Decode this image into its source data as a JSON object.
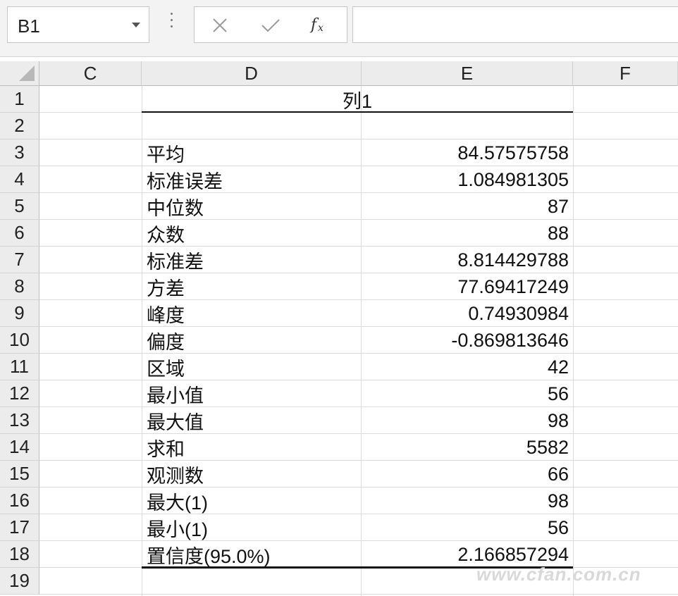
{
  "formula_bar": {
    "name_box": "B1",
    "formula": ""
  },
  "columns": [
    {
      "label": "C"
    },
    {
      "label": "D"
    },
    {
      "label": "E"
    },
    {
      "label": "F"
    }
  ],
  "rows": [
    "1",
    "2",
    "3",
    "4",
    "5",
    "6",
    "7",
    "8",
    "9",
    "10",
    "11",
    "12",
    "13",
    "14",
    "15",
    "16",
    "17",
    "18",
    "19"
  ],
  "table": {
    "header": "列1",
    "stats": [
      {
        "label": "平均",
        "value": "84.57575758"
      },
      {
        "label": "标准误差",
        "value": "1.084981305"
      },
      {
        "label": "中位数",
        "value": "87"
      },
      {
        "label": "众数",
        "value": "88"
      },
      {
        "label": "标准差",
        "value": "8.814429788"
      },
      {
        "label": "方差",
        "value": "77.69417249"
      },
      {
        "label": "峰度",
        "value": "0.74930984"
      },
      {
        "label": "偏度",
        "value": "-0.869813646"
      },
      {
        "label": "区域",
        "value": "42"
      },
      {
        "label": "最小值",
        "value": "56"
      },
      {
        "label": "最大值",
        "value": "98"
      },
      {
        "label": "求和",
        "value": "5582"
      },
      {
        "label": "观测数",
        "value": "66"
      },
      {
        "label": "最大(1)",
        "value": "98"
      },
      {
        "label": "最小(1)",
        "value": "56"
      },
      {
        "label": "置信度(95.0%)",
        "value": "2.166857294"
      }
    ]
  },
  "watermark": "www.cfan.com.cn"
}
